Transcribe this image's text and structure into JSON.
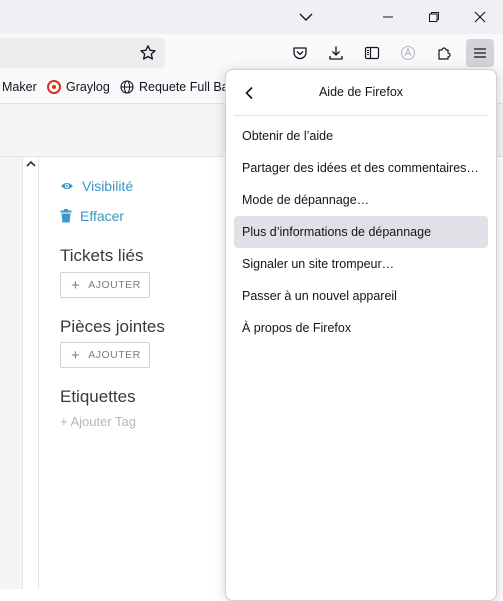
{
  "titlebar": {
    "buttons": [
      {
        "name": "list-all-tabs",
        "icon": "chevron-down-icon"
      },
      {
        "name": "minimize",
        "icon": "minimize-icon"
      },
      {
        "name": "restore",
        "icon": "restore-icon"
      },
      {
        "name": "close",
        "icon": "close-icon"
      }
    ]
  },
  "toolbar": {
    "icons": [
      "pocket-icon",
      "downloads-icon",
      "sidebar-icon",
      "translate-icon",
      "extensions-icon",
      "menu-icon"
    ]
  },
  "bookmarks": [
    {
      "label": "Maker"
    },
    {
      "label": "Graylog"
    },
    {
      "label": "Requete Full Bas"
    }
  ],
  "page": {
    "visibility_label": "Visibilité",
    "delete_label": "Effacer",
    "linked_tickets_title": "Tickets liés",
    "attachments_title": "Pièces jointes",
    "labels_title": "Etiquettes",
    "add_label": "AJOUTER",
    "add_tag_label": "+ Ajouter Tag"
  },
  "help_menu": {
    "title": "Aide de Firefox",
    "items": [
      "Obtenir de l’aide",
      "Partager des idées et des commentaires…",
      "Mode de dépannage…",
      "Plus d’informations de dépannage",
      "Signaler un site trompeur…",
      "Passer à un nouvel appareil",
      "À propos de Firefox"
    ],
    "highlighted_index": 3
  },
  "colors": {
    "link_blue": "#3798c9",
    "menu_hover": "#e0e0e6",
    "graylog_red": "#d93025"
  }
}
